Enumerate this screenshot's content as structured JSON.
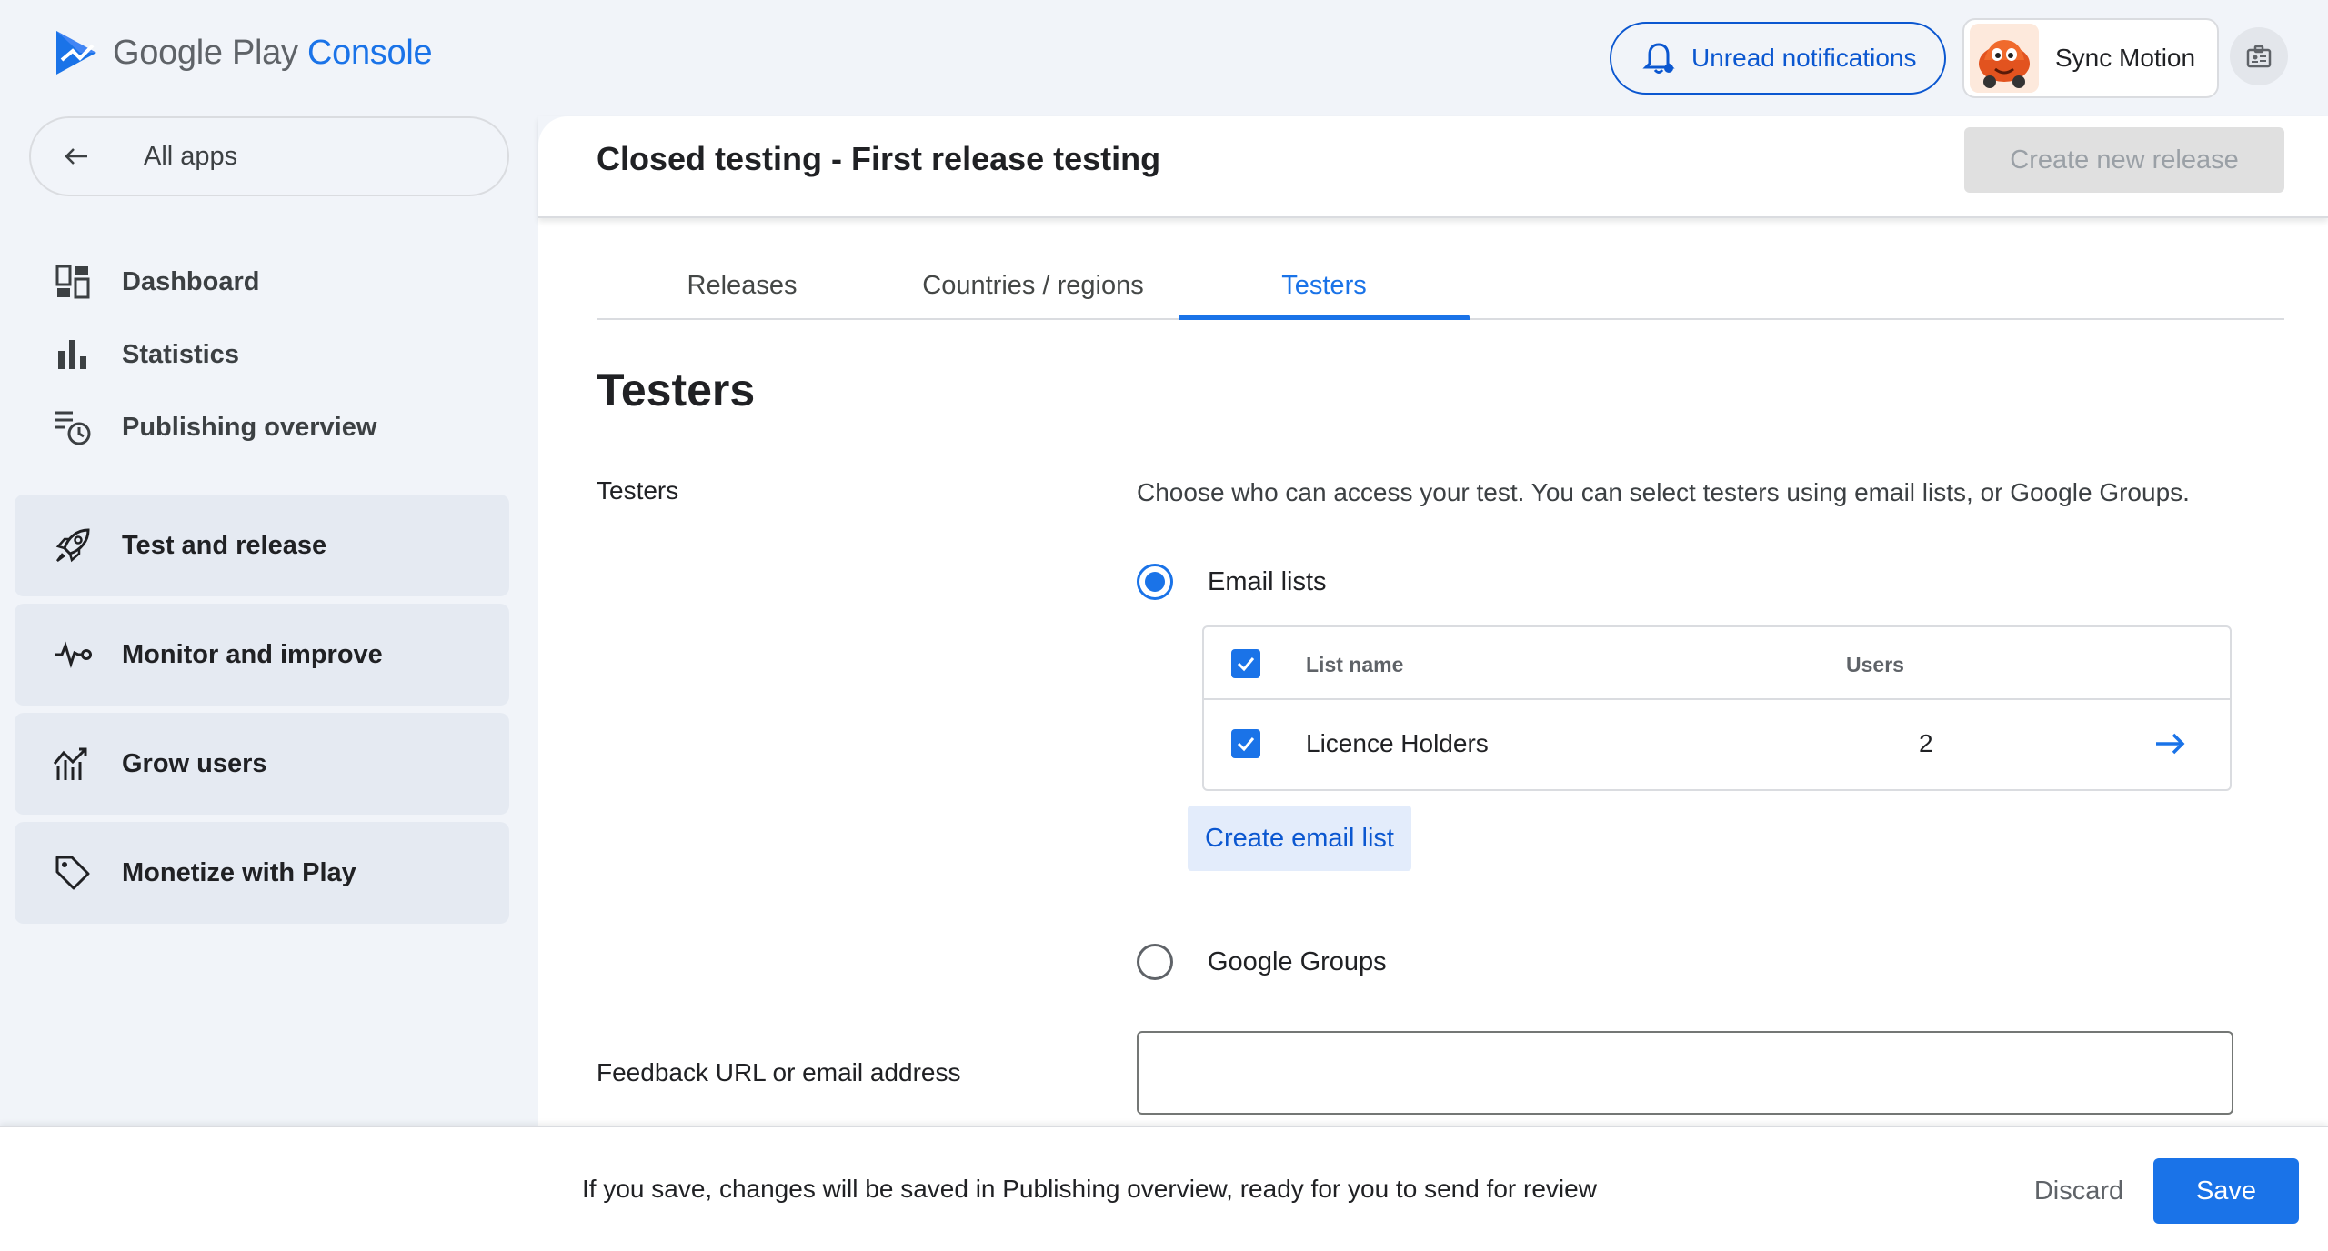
{
  "header": {
    "logo_prefix": "Google Play",
    "logo_accent": "Console",
    "notifications_label": "Unread notifications",
    "account_name": "Sync Motion"
  },
  "sidebar": {
    "all_apps": "All apps",
    "items": [
      {
        "label": "Dashboard",
        "icon": "dashboard-icon"
      },
      {
        "label": "Statistics",
        "icon": "bar-chart-icon"
      },
      {
        "label": "Publishing overview",
        "icon": "publishing-overview-icon"
      }
    ],
    "sections": [
      {
        "label": "Test and release",
        "icon": "rocket-icon"
      },
      {
        "label": "Monitor and improve",
        "icon": "vitals-icon"
      },
      {
        "label": "Grow users",
        "icon": "growth-icon"
      },
      {
        "label": "Monetize with Play",
        "icon": "tag-icon"
      }
    ]
  },
  "main": {
    "title": "Closed testing - First release testing",
    "create_release": "Create new release",
    "tabs": [
      {
        "label": "Releases",
        "active": false
      },
      {
        "label": "Countries / regions",
        "active": false
      },
      {
        "label": "Testers",
        "active": true
      }
    ],
    "section_heading": "Testers",
    "testers_label": "Testers",
    "testers_description": "Choose who can access your test. You can select testers using email lists, or Google Groups.",
    "email_lists_option": "Email lists",
    "email_lists_selected": true,
    "table": {
      "col_list_name": "List name",
      "col_users": "Users",
      "rows": [
        {
          "name": "Licence Holders",
          "users": "2",
          "checked": true
        }
      ]
    },
    "create_email_list": "Create email list",
    "google_groups_option": "Google Groups",
    "feedback_label": "Feedback URL or email address",
    "feedback_value": ""
  },
  "footer": {
    "message": "If you save, changes will be saved in Publishing overview, ready for you to send for review",
    "discard": "Discard",
    "save": "Save"
  },
  "colors": {
    "accent": "#1a73e8",
    "background": "#f1f4f9",
    "section_bg": "#e5eaf2"
  }
}
